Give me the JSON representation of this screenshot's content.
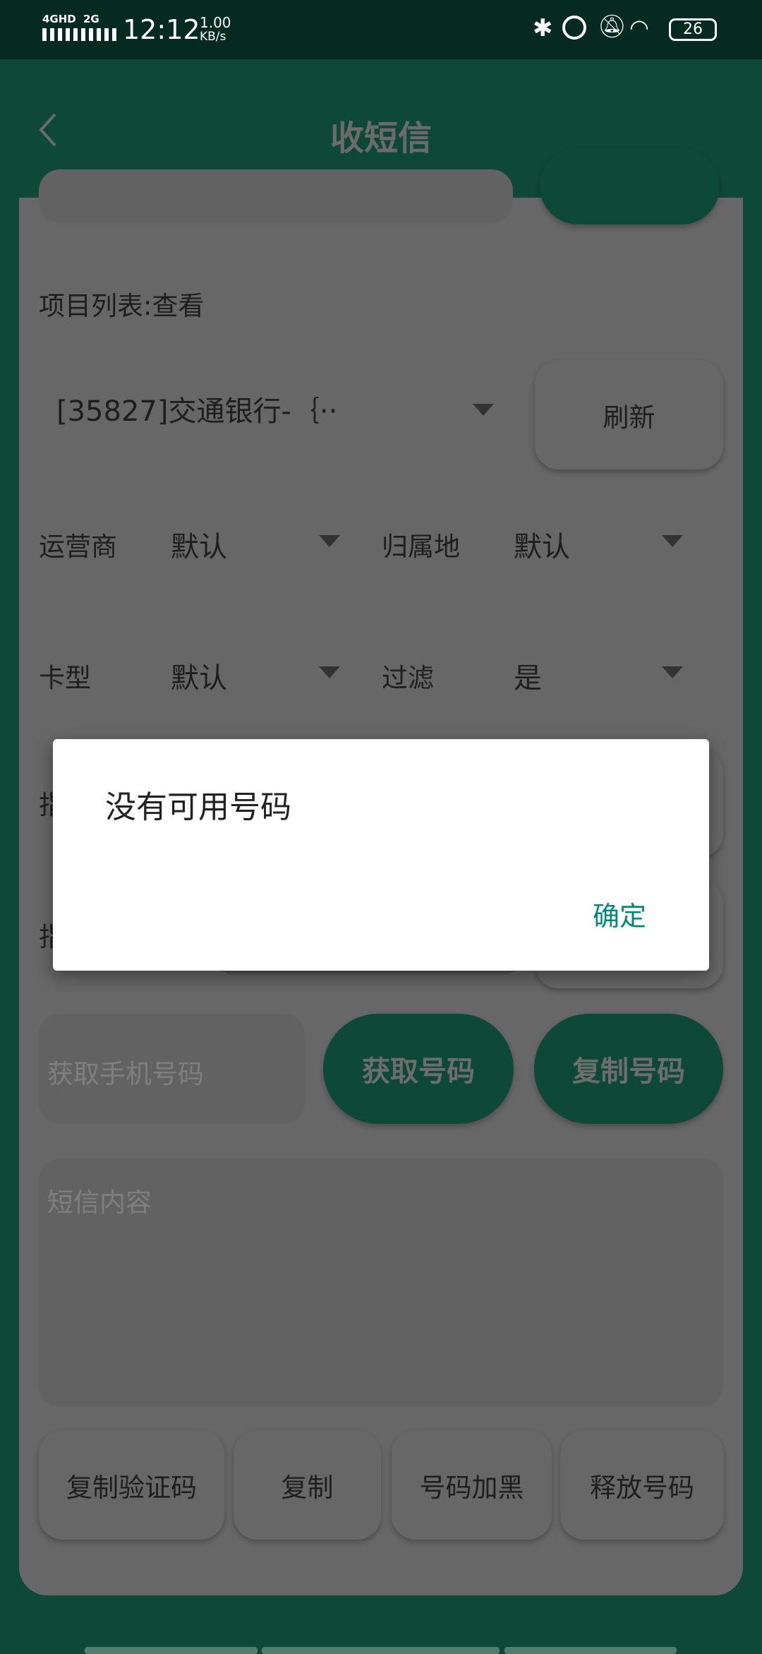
{
  "status_bar": {
    "network1": "4GHD",
    "network2": "2G",
    "time": "12:12",
    "speed_value": "1.00",
    "speed_unit": "KB/s",
    "battery": "26",
    "icons": [
      "signal-icon",
      "bluetooth-icon",
      "alarm-icon",
      "bell-off-icon",
      "wifi-icon",
      "battery-icon"
    ]
  },
  "header": {
    "title": "收短信",
    "back_icon": "chevron-left-icon"
  },
  "form": {
    "project_list_label": "项目列表:查看",
    "project_selected": "[35827]交通银行-｛··",
    "refresh_label": "刷新",
    "operator_label": "运营商",
    "operator_value": "默认",
    "location_label": "归属地",
    "location_value": "默认",
    "card_type_label": "卡型",
    "card_type_value": "默认",
    "filter_label": "过滤",
    "filter_value": "是",
    "row5_label_partial": "指",
    "row6_label_partial": "指",
    "phone_placeholder": "获取手机号码",
    "get_number_label": "获取号码",
    "copy_number_label": "复制号码",
    "sms_placeholder": "短信内容"
  },
  "actions": [
    "复制验证码",
    "复制",
    "号码加黑",
    "释放号码"
  ],
  "dialog": {
    "message": "没有可用号码",
    "ok_label": "确定"
  },
  "colors": {
    "primary": "#0e4837",
    "status_bar": "#072a20",
    "dialog_button": "#00897b"
  }
}
